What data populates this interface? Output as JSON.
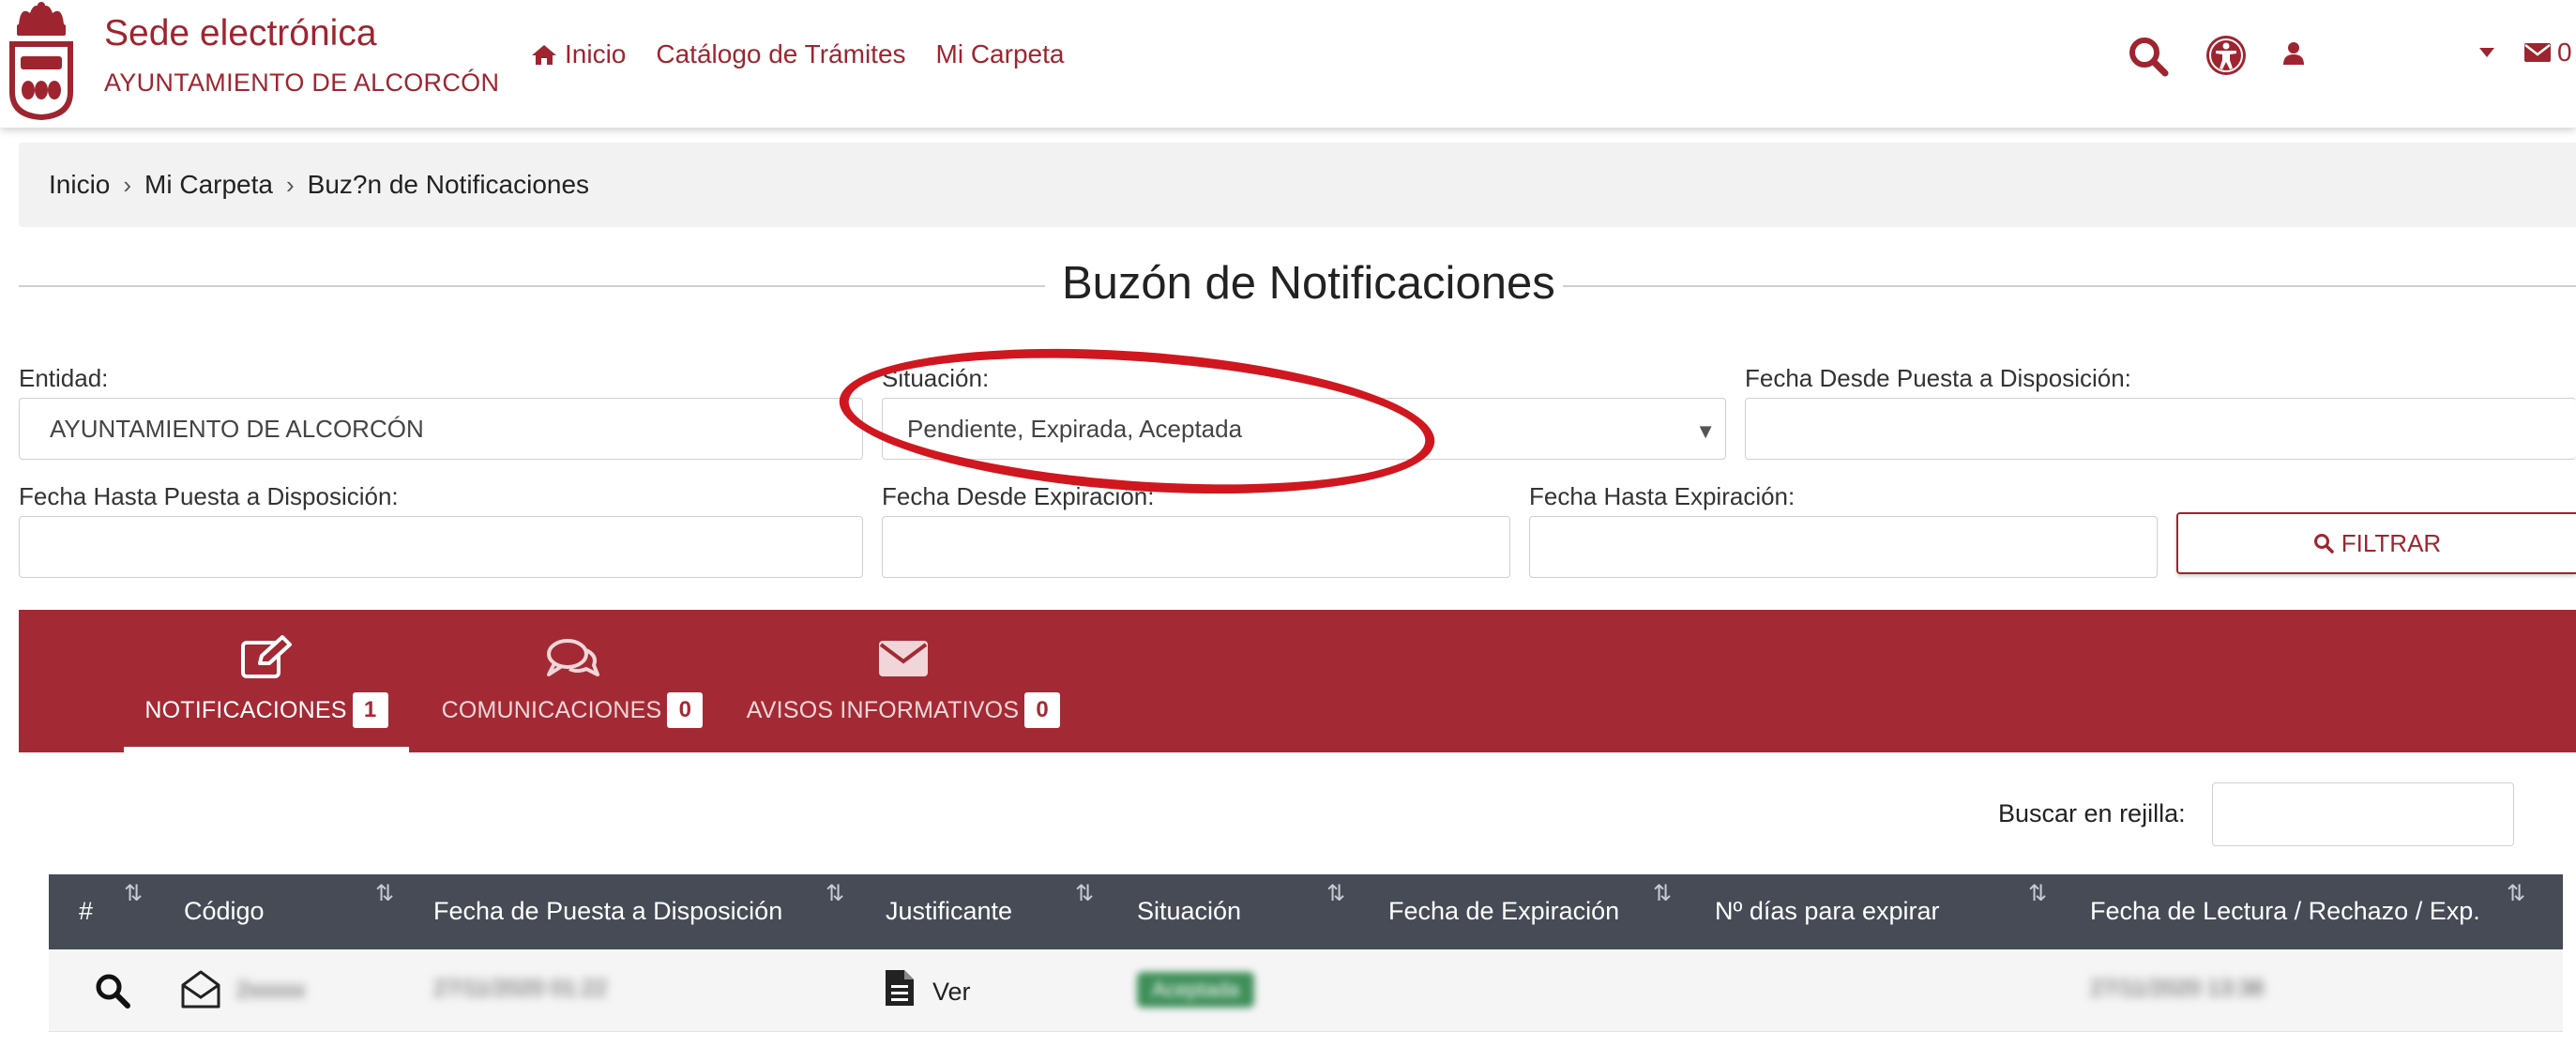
{
  "header": {
    "site_title": "Sede electrónica",
    "site_subtitle": "AYUNTAMIENTO DE ALCORCÓN",
    "nav": [
      {
        "label": "Inicio",
        "icon": "home-icon"
      },
      {
        "label": "Catálogo de Trámites"
      },
      {
        "label": "Mi Carpeta"
      }
    ],
    "messages_count": "0",
    "icons": [
      "search-icon",
      "accessibility-icon",
      "user-icon",
      "caret-down-icon",
      "envelope-icon"
    ]
  },
  "breadcrumb": [
    "Inicio",
    "Mi Carpeta",
    "Buz?n de Notificaciones"
  ],
  "page_title": "Buzón de Notificaciones",
  "filters": {
    "entidad_label": "Entidad:",
    "entidad_value": "AYUNTAMIENTO DE ALCORCÓN",
    "situacion_label": "Situación:",
    "situacion_value": "Pendiente, Expirada, Aceptada",
    "fecha_desde_puesta_label": "Fecha Desde Puesta a Disposición:",
    "fecha_hasta_puesta_label": "Fecha Hasta Puesta a Disposición:",
    "fecha_desde_exp_label": "Fecha Desde Expiración:",
    "fecha_hasta_exp_label": "Fecha Hasta Expiración:",
    "filter_button": "FILTRAR"
  },
  "tabs": [
    {
      "label": "NOTIFICACIONES",
      "count": "1",
      "icon": "edit-icon",
      "active": true
    },
    {
      "label": "COMUNICACIONES",
      "count": "0",
      "icon": "comments-icon",
      "active": false
    },
    {
      "label": "AVISOS INFORMATIVOS",
      "count": "0",
      "icon": "envelope-icon",
      "active": false
    }
  ],
  "grid": {
    "search_label": "Buscar en rejilla:",
    "columns": [
      "#",
      "Código",
      "Fecha de Puesta a Disposición",
      "Justificante",
      "Situación",
      "Fecha de Expiración",
      "Nº días para expirar",
      "Fecha de Lectura / Rechazo / Exp."
    ],
    "rows": [
      {
        "codigo": "2xxxxx",
        "fecha_puesta": "27/11/2020 01:22",
        "justificante": "Ver",
        "situacion": "Aceptada",
        "fecha_lectura": "27/11/2020 13:38"
      }
    ]
  },
  "colors": {
    "brand": "#9e2530",
    "tab_bg": "#a32a34",
    "table_header": "#464b55",
    "annotation": "#d0171f"
  }
}
